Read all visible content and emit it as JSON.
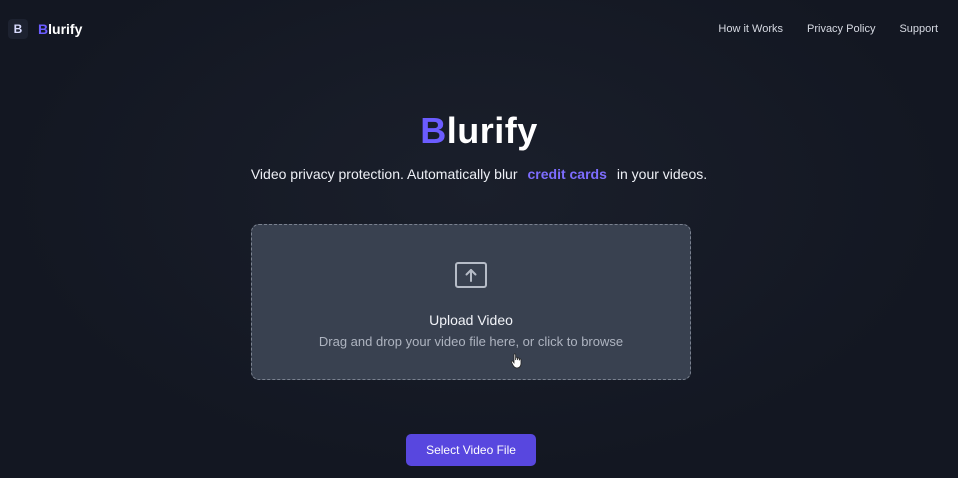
{
  "header": {
    "brand_logo_text": "B",
    "brand_name_accent": "B",
    "brand_name_rest": "lurify",
    "nav": [
      {
        "label": "How it Works"
      },
      {
        "label": "Privacy Policy"
      },
      {
        "label": "Support"
      }
    ]
  },
  "hero": {
    "title_accent": "B",
    "title_rest": "lurify",
    "tagline_prefix": "Video privacy protection. Automatically blur",
    "tagline_highlight": "credit cards",
    "tagline_suffix": "in your videos."
  },
  "upload": {
    "icon": "upload-arrow-icon",
    "title": "Upload Video",
    "subtitle": "Drag and drop your video file here, or click to browse"
  },
  "actions": {
    "select_label": "Select Video File"
  },
  "colors": {
    "background": "#131722",
    "accent": "#6b5cff",
    "button": "#5847df",
    "dropzone": "#394150"
  }
}
